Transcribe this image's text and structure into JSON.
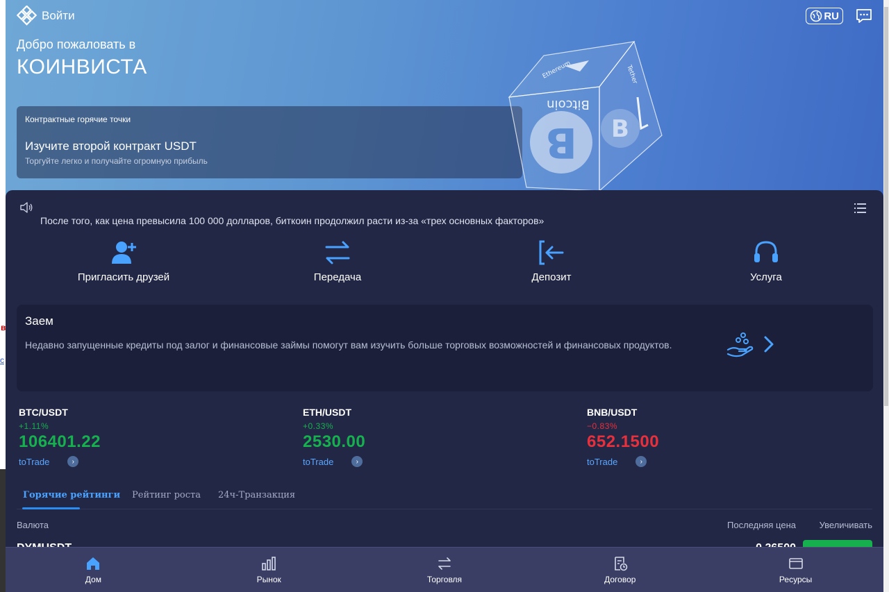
{
  "header": {
    "login_label": "Войти",
    "lang_label": "RU",
    "logo_icon": "diamond-logo-icon",
    "chat_icon": "chat-icon"
  },
  "hero": {
    "welcome": "Добро пожаловать в",
    "brand": "КОИНВИСТА",
    "promo_caption": "Контрактные горячие точки",
    "promo_title": "Изучите второй контракт USDT",
    "promo_subtitle": "Торгуйте легко и получайте огромную прибыль",
    "cube_text_1": "Bitcoin",
    "cube_text_2": "Ethereum",
    "cube_text_3": "Tether"
  },
  "news": {
    "text": "После того, как цена превысила 100 000 долларов, биткоин продолжил расти из-за «трех основных факторов»"
  },
  "quick_actions": [
    {
      "label": "Пригласить друзей",
      "icon": "invite-user-icon"
    },
    {
      "label": "Передача",
      "icon": "transfer-arrows-icon"
    },
    {
      "label": "Депозит",
      "icon": "deposit-icon"
    },
    {
      "label": "Услуга",
      "icon": "headset-icon"
    }
  ],
  "loan": {
    "title": "Заем",
    "description": "Недавно запущенные кредиты под залог и финансовые займы помогут вам изучить больше торговых возможностей и финансовых продуктов."
  },
  "tickers": [
    {
      "pair": "BTC/USDT",
      "change": "+1.11%",
      "price": "106401.22",
      "trade": "toTrade",
      "direction": "up"
    },
    {
      "pair": "ETH/USDT",
      "change": "+0.33%",
      "price": "2530.00",
      "trade": "toTrade",
      "direction": "up"
    },
    {
      "pair": "BNB/USDT",
      "change": "−0.83%",
      "price": "652.1500",
      "trade": "toTrade",
      "direction": "down"
    }
  ],
  "rank_tabs": [
    "Горячие рейтинги",
    "Рейтинг роста",
    "24ч-Транзакция"
  ],
  "table": {
    "col_currency": "Валюта",
    "col_last_price": "Последняя цена",
    "col_increase": "Увеличивать",
    "first_row_symbol": "DYMUSDT",
    "first_row_price": "0.26500"
  },
  "bottom_nav": [
    {
      "label": "Дом",
      "icon": "home-icon"
    },
    {
      "label": "Рынок",
      "icon": "market-bars-icon"
    },
    {
      "label": "Торговля",
      "icon": "trade-arrows-icon"
    },
    {
      "label": "Договор",
      "icon": "contract-icon"
    },
    {
      "label": "Ресурсы",
      "icon": "wallet-icon"
    }
  ],
  "colors": {
    "up": "#17b04f",
    "down": "#e6313d",
    "accent": "#4aa2ff",
    "panel": "#232746"
  }
}
